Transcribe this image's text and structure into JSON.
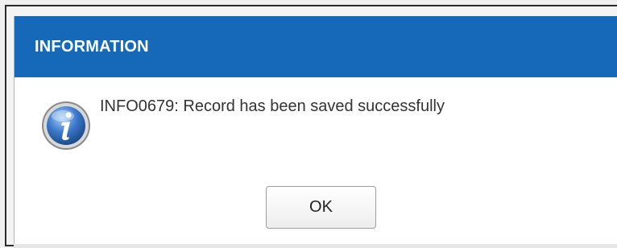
{
  "dialog": {
    "title": "INFORMATION",
    "icon": "info-icon",
    "message": "INFO0679: Record has been saved successfully",
    "ok_label": "OK"
  },
  "colors": {
    "titlebar": "#1569b8",
    "title_text": "#ffffff",
    "icon_blue": "#3a78c9"
  }
}
